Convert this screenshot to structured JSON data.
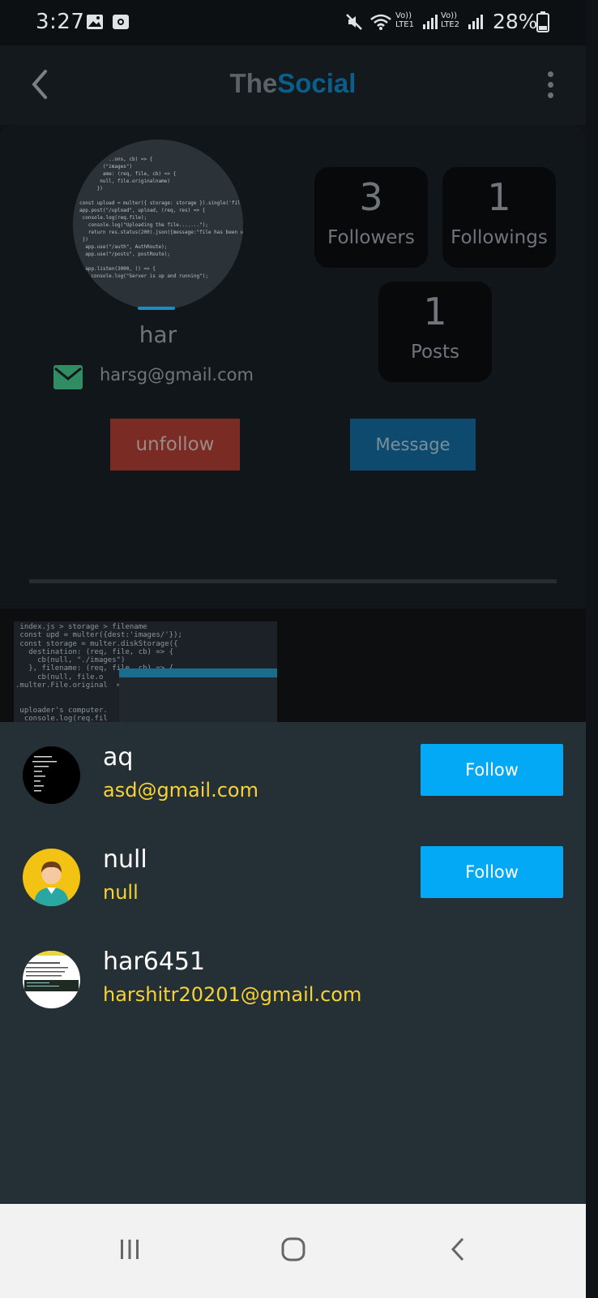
{
  "status_bar": {
    "time": "3:27",
    "lte1": "Vo)) LTE1",
    "lte2": "Vo)) LTE2",
    "battery": "28%",
    "icons": [
      "gallery-icon",
      "screen-record-icon",
      "mute-icon",
      "wifi-icon",
      "signal-icon",
      "battery-icon"
    ]
  },
  "app_bar": {
    "title_part1": "The",
    "title_part2": "Social",
    "back_icon": "back-arrow-icon",
    "menu_icon": "more-vert-icon"
  },
  "profile": {
    "username": "har",
    "email": "harsg@gmail.com",
    "followers_count": "3",
    "followers_label": "Followers",
    "followings_count": "1",
    "followings_label": "Followings",
    "posts_count": "1",
    "posts_label": "Posts",
    "unfollow_label": "unfollow",
    "message_label": "Message"
  },
  "user_list": [
    {
      "name": "aq",
      "email": "asd@gmail.com",
      "button": "Follow",
      "avatar": "dark"
    },
    {
      "name": "null",
      "email": "null",
      "button": "Follow",
      "avatar": "default-person"
    },
    {
      "name": "har6451",
      "email": "harshitr20201@gmail.com",
      "button": "",
      "avatar": "white"
    }
  ],
  "colors": {
    "follow_button": "#03a9f4",
    "email_text": "#f6d235",
    "brand_blue": "#0a5f8a",
    "unfollow": "#7a2b23"
  }
}
